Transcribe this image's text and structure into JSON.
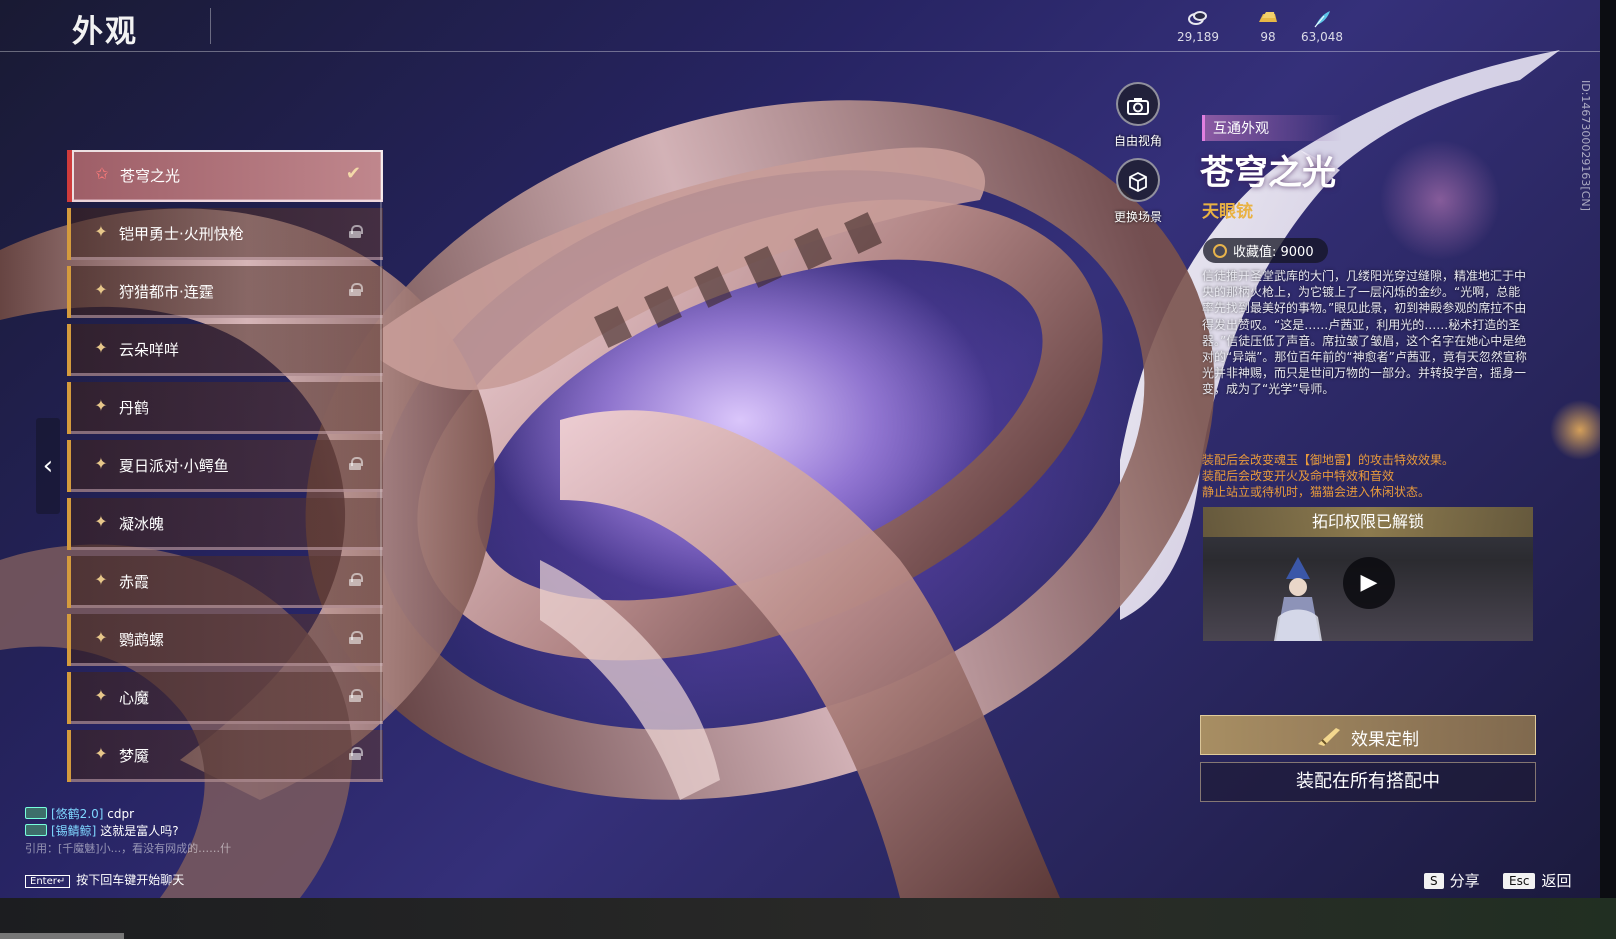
{
  "header": {
    "title": "外观",
    "currencies": [
      {
        "icon": "coin-stack-icon",
        "value": "29,189"
      },
      {
        "icon": "gold-bar-icon",
        "value": "98"
      },
      {
        "icon": "feather-icon",
        "value": "63,048"
      }
    ],
    "player_id": "ID:1467300029163[CN]"
  },
  "skins": [
    {
      "name": "苍穹之光",
      "selected": true,
      "locked": false
    },
    {
      "name": "铠甲勇士·火刑快枪",
      "selected": false,
      "locked": true
    },
    {
      "name": "狩猎都市·连霆",
      "selected": false,
      "locked": true
    },
    {
      "name": "云朵咩咩",
      "selected": false,
      "locked": false
    },
    {
      "name": "丹鹤",
      "selected": false,
      "locked": false
    },
    {
      "name": "夏日派对·小鳄鱼",
      "selected": false,
      "locked": true
    },
    {
      "name": "凝冰魄",
      "selected": false,
      "locked": false
    },
    {
      "name": "赤霞",
      "selected": false,
      "locked": true
    },
    {
      "name": "鹦鹉螺",
      "selected": false,
      "locked": true
    },
    {
      "name": "心魔",
      "selected": false,
      "locked": true
    },
    {
      "name": "梦魇",
      "selected": false,
      "locked": true
    }
  ],
  "tools": {
    "free_view": "自由视角",
    "change_scene": "更换场景"
  },
  "detail": {
    "tag": "互通外观",
    "title": "苍穹之光",
    "type": "天眼铳",
    "collect_label": "收藏值: 9000",
    "description": "信徒推开圣堂武库的大门，几缕阳光穿过缝隙，精准地汇于中央的那柄火枪上，为它镀上了一层闪烁的金纱。“光啊，总能率先找到最美好的事物。”眼见此景，初到神殿参观的席拉不由得发出赞叹。“这是……卢茜亚，利用光的……秘术打造的圣器。”信徒压低了声音。席拉皱了皱眉，这个名字在她心中是绝对的“异端”。那位百年前的“神愈者”卢茜亚，竟有天忽然宣称光并非神赐，而只是世间万物的一部分。并转投学宫，摇身一变，成为了“光学”导师。",
    "effects": [
      "装配后会改变魂玉【御地雷】的攻击特效效果。",
      "装配后会改变开火及命中特效和音效",
      "静止站立或待机时，猫猫会进入休闲状态。"
    ],
    "video_header": "拓印权限已解锁",
    "effect_button": "效果定制",
    "equip_button": "装配在所有搭配中"
  },
  "footer": {
    "share_key": "S",
    "share_label": "分享",
    "back_key": "Esc",
    "back_label": "返回"
  },
  "chat": {
    "messages": [
      {
        "name": "[悠鹤2.0]",
        "text": "cdpr"
      },
      {
        "name": "[锡鲭鲸]",
        "text": "这就是富人吗?"
      }
    ],
    "quote": "引用：[千魔魅]小...，看没有网成的……什",
    "input_key": "Enter↵",
    "input_hint": "按下回车键开始聊天"
  },
  "colors": {
    "accent_gold": "#d49b3d",
    "selected_red": "#cf3b3b",
    "effect_orange": "#e89a3c",
    "type_gold": "#e9b243"
  }
}
